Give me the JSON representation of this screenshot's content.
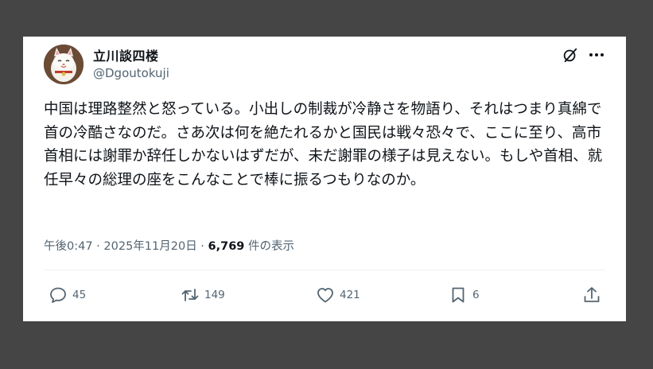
{
  "author": {
    "name": "立川談四楼",
    "handle": "@Dgoutokuji"
  },
  "tweet": {
    "text": "中国は理路整然と怒っている。小出しの制裁が冷静さを物語り、それはつまり真綿で首の冷酷さなのだ。さあ次は何を絶たれるかと国民は戦々恐々で、ここに至り、高市首相には謝罪か辞任しかないはずだが、未だ謝罪の様子は見えない。もしや首相、就任早々の総理の座をこんなことで棒に振るつもりなのか。"
  },
  "meta": {
    "time": "午後0:47",
    "sep1": " · ",
    "date": "2025年11月20日",
    "sep2": " · ",
    "views_count": "6,769",
    "views_label": " 件の表示"
  },
  "actions": {
    "replies": "45",
    "reposts": "149",
    "likes": "421",
    "bookmarks": "6"
  },
  "icons": [
    "grok-icon",
    "more-icon",
    "reply-icon",
    "repost-icon",
    "like-icon",
    "bookmark-icon",
    "share-icon"
  ],
  "colors": {
    "text": "#0f1419",
    "secondary": "#536471",
    "background": "#454545",
    "card": "#ffffff"
  }
}
